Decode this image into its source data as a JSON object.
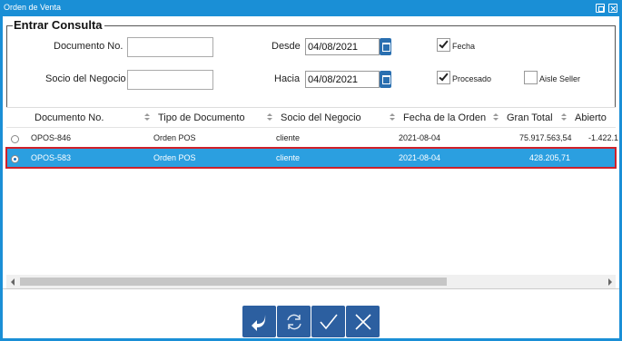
{
  "window": {
    "title": "Orden de Venta"
  },
  "group": {
    "title": "Entrar Consulta"
  },
  "form": {
    "documento_label": "Documento No.",
    "documento_value": "",
    "socio_label": "Socio del Negocio",
    "socio_value": "",
    "desde_label": "Desde",
    "desde_value": "04/08/2021",
    "hacia_label": "Hacia",
    "hacia_value": "04/08/2021",
    "fecha_label": "Fecha",
    "fecha_checked": true,
    "procesado_label": "Procesado",
    "procesado_checked": true,
    "aisle_label": "Aisle Seller",
    "aisle_checked": false
  },
  "table": {
    "columns": [
      "Documento No.",
      "Tipo de Documento",
      "Socio del Negocio",
      "Fecha de la Orden",
      "Gran Total",
      "Abierto"
    ],
    "rows": [
      {
        "doc": "OPOS-846",
        "tipo": "Orden POS",
        "socio": "cliente",
        "fecha": "2021-08-04",
        "total": "75.917.563,54",
        "abierto": "-1.422.1",
        "selected": false
      },
      {
        "doc": "OPOS-583",
        "tipo": "Orden POS",
        "socio": "cliente",
        "fecha": "2021-08-04",
        "total": "428.205,71",
        "abierto": "",
        "selected": true
      }
    ]
  },
  "actions": [
    "back-arrow-icon",
    "refresh-icon",
    "check-icon",
    "close-icon"
  ],
  "colors": {
    "accent": "#1a8fd6",
    "selected_row": "#2b9fe0",
    "button": "#2c5fa0",
    "highlight_border": "#d0202a"
  }
}
